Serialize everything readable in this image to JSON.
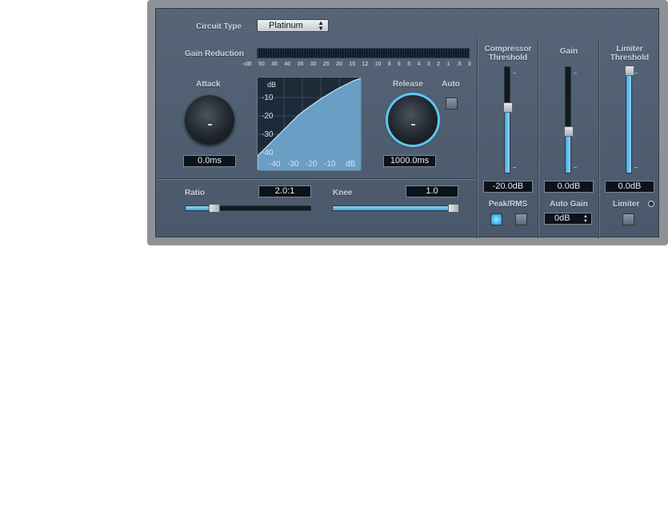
{
  "header": {
    "circuit_type_label": "Circuit Type",
    "circuit_type_value": "Platinum"
  },
  "gain_reduction": {
    "label": "Gain Reduction",
    "scale": [
      "-dB",
      "50",
      "45",
      "40",
      "35",
      "30",
      "25",
      "20",
      "15",
      "12",
      "10",
      "8",
      "6",
      "5",
      "4",
      "3",
      "2",
      "1",
      ".5",
      "0"
    ]
  },
  "attack": {
    "label": "Attack",
    "value": "0.0ms"
  },
  "release": {
    "label": "Release",
    "value": "1000.0ms"
  },
  "auto": {
    "label": "Auto",
    "active": false
  },
  "graph": {
    "y_unit": "dB",
    "y_ticks": [
      "-10",
      "-20",
      "-30",
      "-40"
    ],
    "x_ticks": [
      "-40",
      "-30",
      "-20",
      "-10"
    ],
    "x_unit": "dB"
  },
  "ratio": {
    "label": "Ratio",
    "value": "2.0:1",
    "level": 0.2
  },
  "knee": {
    "label": "Knee",
    "value": "1.0",
    "level": 1.0
  },
  "compressor_threshold": {
    "label_line1": "Compressor",
    "label_line2": "Threshold",
    "value": "-20.0dB",
    "level": 0.62
  },
  "peak_rms": {
    "label": "Peak/RMS",
    "peak_active": true,
    "rms_active": false
  },
  "gain": {
    "label": "Gain",
    "value": "0.0dB",
    "level": 0.37
  },
  "auto_gain": {
    "label": "Auto Gain",
    "value": "0dB"
  },
  "limiter_threshold": {
    "label_line1": "Limiter",
    "label_line2": "Threshold",
    "value": "0.0dB",
    "level": 1.0
  },
  "limiter": {
    "label": "Limiter",
    "active": false
  }
}
